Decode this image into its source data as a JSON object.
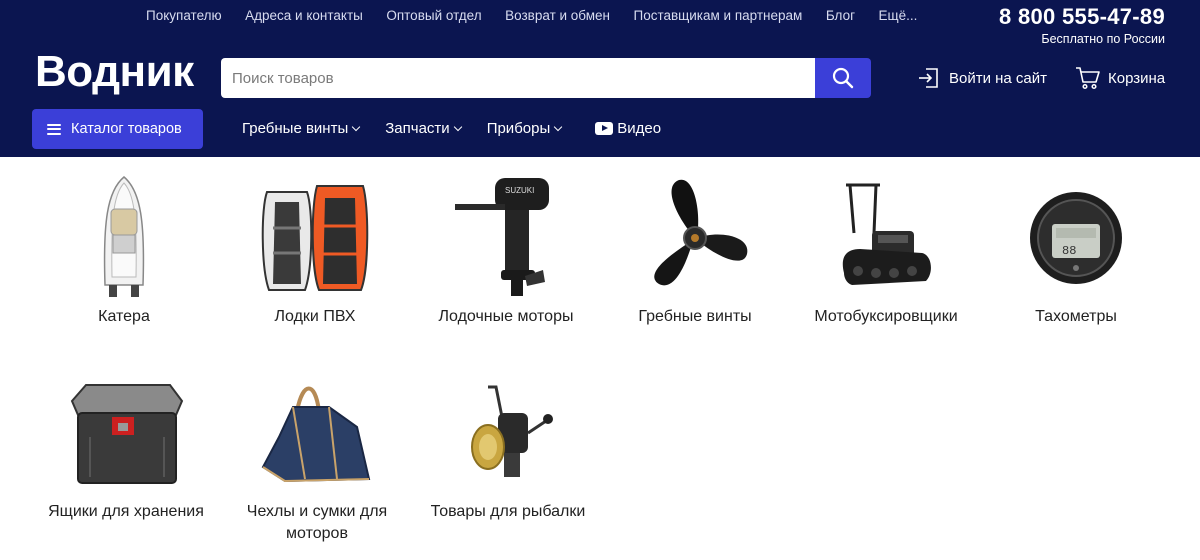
{
  "topnav": [
    "Покупателю",
    "Адреса и контакты",
    "Оптовый отдел",
    "Возврат и обмен",
    "Поставщикам и партнерам",
    "Блог",
    "Ещё..."
  ],
  "contact": {
    "phone": "8 800 555-47-89",
    "phone_note": "Бесплатно по России"
  },
  "logo": "Водник",
  "search": {
    "placeholder": "Поиск товаров",
    "value": ""
  },
  "login_label": "Войти на сайт",
  "cart_label": "Корзина",
  "catalog_label": "Каталог товаров",
  "mainnav": [
    {
      "label": "Гребные винты",
      "dropdown": true
    },
    {
      "label": "Запчасти",
      "dropdown": true
    },
    {
      "label": "Приборы",
      "dropdown": true
    },
    {
      "label": "Видео",
      "icon": "youtube-icon"
    }
  ],
  "categories": [
    {
      "label": "Катера",
      "image": "boat"
    },
    {
      "label": "Лодки ПВХ",
      "image": "inflatable-boats"
    },
    {
      "label": "Лодочные моторы",
      "image": "outboard-motor"
    },
    {
      "label": "Гребные винты",
      "image": "propeller"
    },
    {
      "label": "Мотобуксировщики",
      "image": "snow-tow"
    },
    {
      "label": "Тахометры",
      "image": "tachometer"
    },
    {
      "label": "Ящики для хранения",
      "image": "storage-box"
    },
    {
      "label": "Чехлы и сумки для моторов",
      "image": "motor-bag"
    },
    {
      "label": "Товары для рыбалки",
      "image": "fishing-reel"
    }
  ],
  "colors": {
    "header_bg": "#0b1550",
    "accent": "#3b3fd8"
  }
}
